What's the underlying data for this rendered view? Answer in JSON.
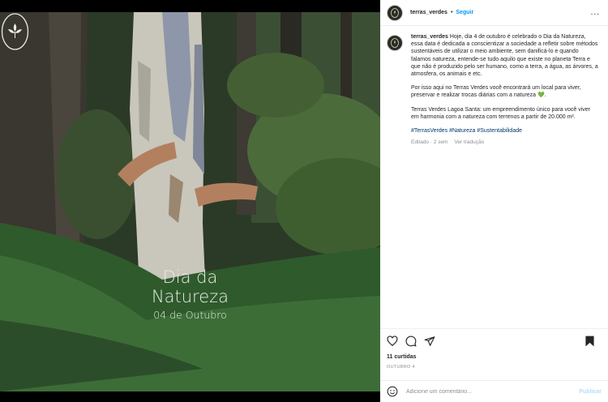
{
  "post": {
    "username": "terras_verdes",
    "separator": "•",
    "follow_label": "Seguir",
    "more_label": "...",
    "caption_user": "terras_verdes",
    "caption_p1": "Hoje, dia 4 de outubro é celebrado o Dia da Natureza, essa data é dedicada a conscientizar a sociedade a refletir sobre métodos sustentáveis de utilizar o meio ambiente, sem danificá-lo e quando falamos natureza, entende-se tudo aquilo que existe no planeta Terra e que não é produzido pelo ser humano, como a terra, a água, as árvores, a atmosfera, os animais e etc.",
    "caption_p2": "Por isso aqui no Terras Verdes você encontrará um local para viver, preservar e realizar trocas diárias com a natureza",
    "caption_p2_emoji": "💚",
    "caption_p2_end": ".",
    "caption_p3": "Terras Verdes Lagoa Santa: um empreendimento único para você viver em harmonia com a natureza com terrenos a partir de 20.000 m².",
    "hashtags": [
      "#TerrasVerdes",
      "#Natureza",
      "#Sustentabilidade"
    ],
    "edited": "Editado · 2 sem",
    "translate": "Ver tradução",
    "likes": "11 curtidas",
    "date": "OUTUBRO 4",
    "comment_placeholder": "Adicione um comentário...",
    "publish_label": "Publicar"
  },
  "image": {
    "title_line1": "Dia da",
    "title_line2": "Natureza",
    "subtitle": "04 de Outubro"
  },
  "icons": {
    "like": "heart-icon",
    "comment": "comment-icon",
    "share": "share-icon",
    "save": "bookmark-icon",
    "emoji": "emoji-icon",
    "more": "more-options-icon"
  },
  "colors": {
    "link": "#0095f6",
    "hashtag": "#00376b",
    "publish_disabled": "#b2dffc"
  }
}
